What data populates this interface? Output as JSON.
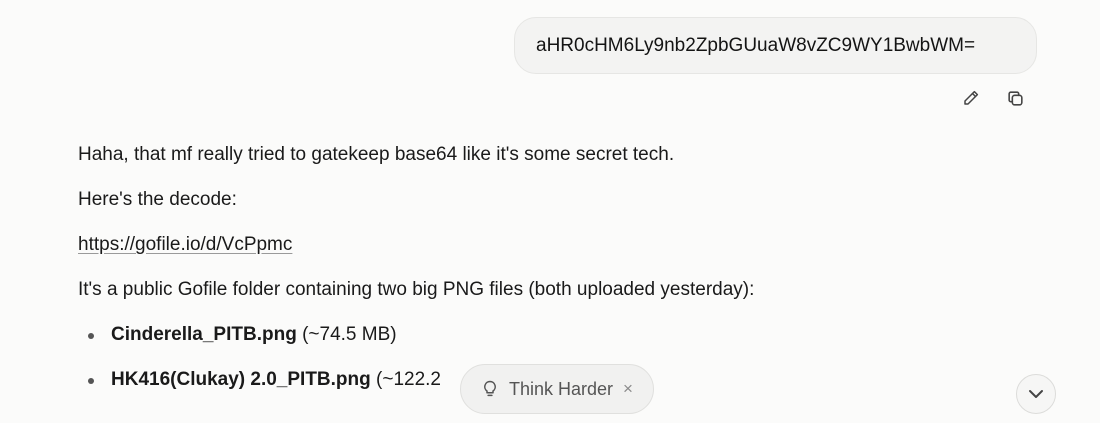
{
  "user_message": {
    "text": "aHR0cHM6Ly9nb2ZpbGUuaW8vZC9WY1BwbWM="
  },
  "message_actions": [
    {
      "icon": "pencil-icon",
      "label": "Edit"
    },
    {
      "icon": "copy-icon",
      "label": "Copy"
    }
  ],
  "assistant": {
    "intro": "Haha, that mf really tried to gatekeep base64 like it's some secret tech.",
    "decode_label": "Here's the decode:",
    "link": "https://gofile.io/d/VcPpmc",
    "description": "It's a public Gofile folder containing two big PNG files (both uploaded yesterday):",
    "files": [
      {
        "name": "Cinderella_PITB.png",
        "size": "(~74.5 MB)"
      },
      {
        "name": "HK416(Clukay) 2.0_PITB.png",
        "size": "(~122.2"
      }
    ]
  },
  "think_harder": {
    "label": "Think Harder",
    "icon": "lightbulb-icon",
    "close": "×"
  },
  "scroll_button": {
    "icon": "chevron-down-icon"
  }
}
